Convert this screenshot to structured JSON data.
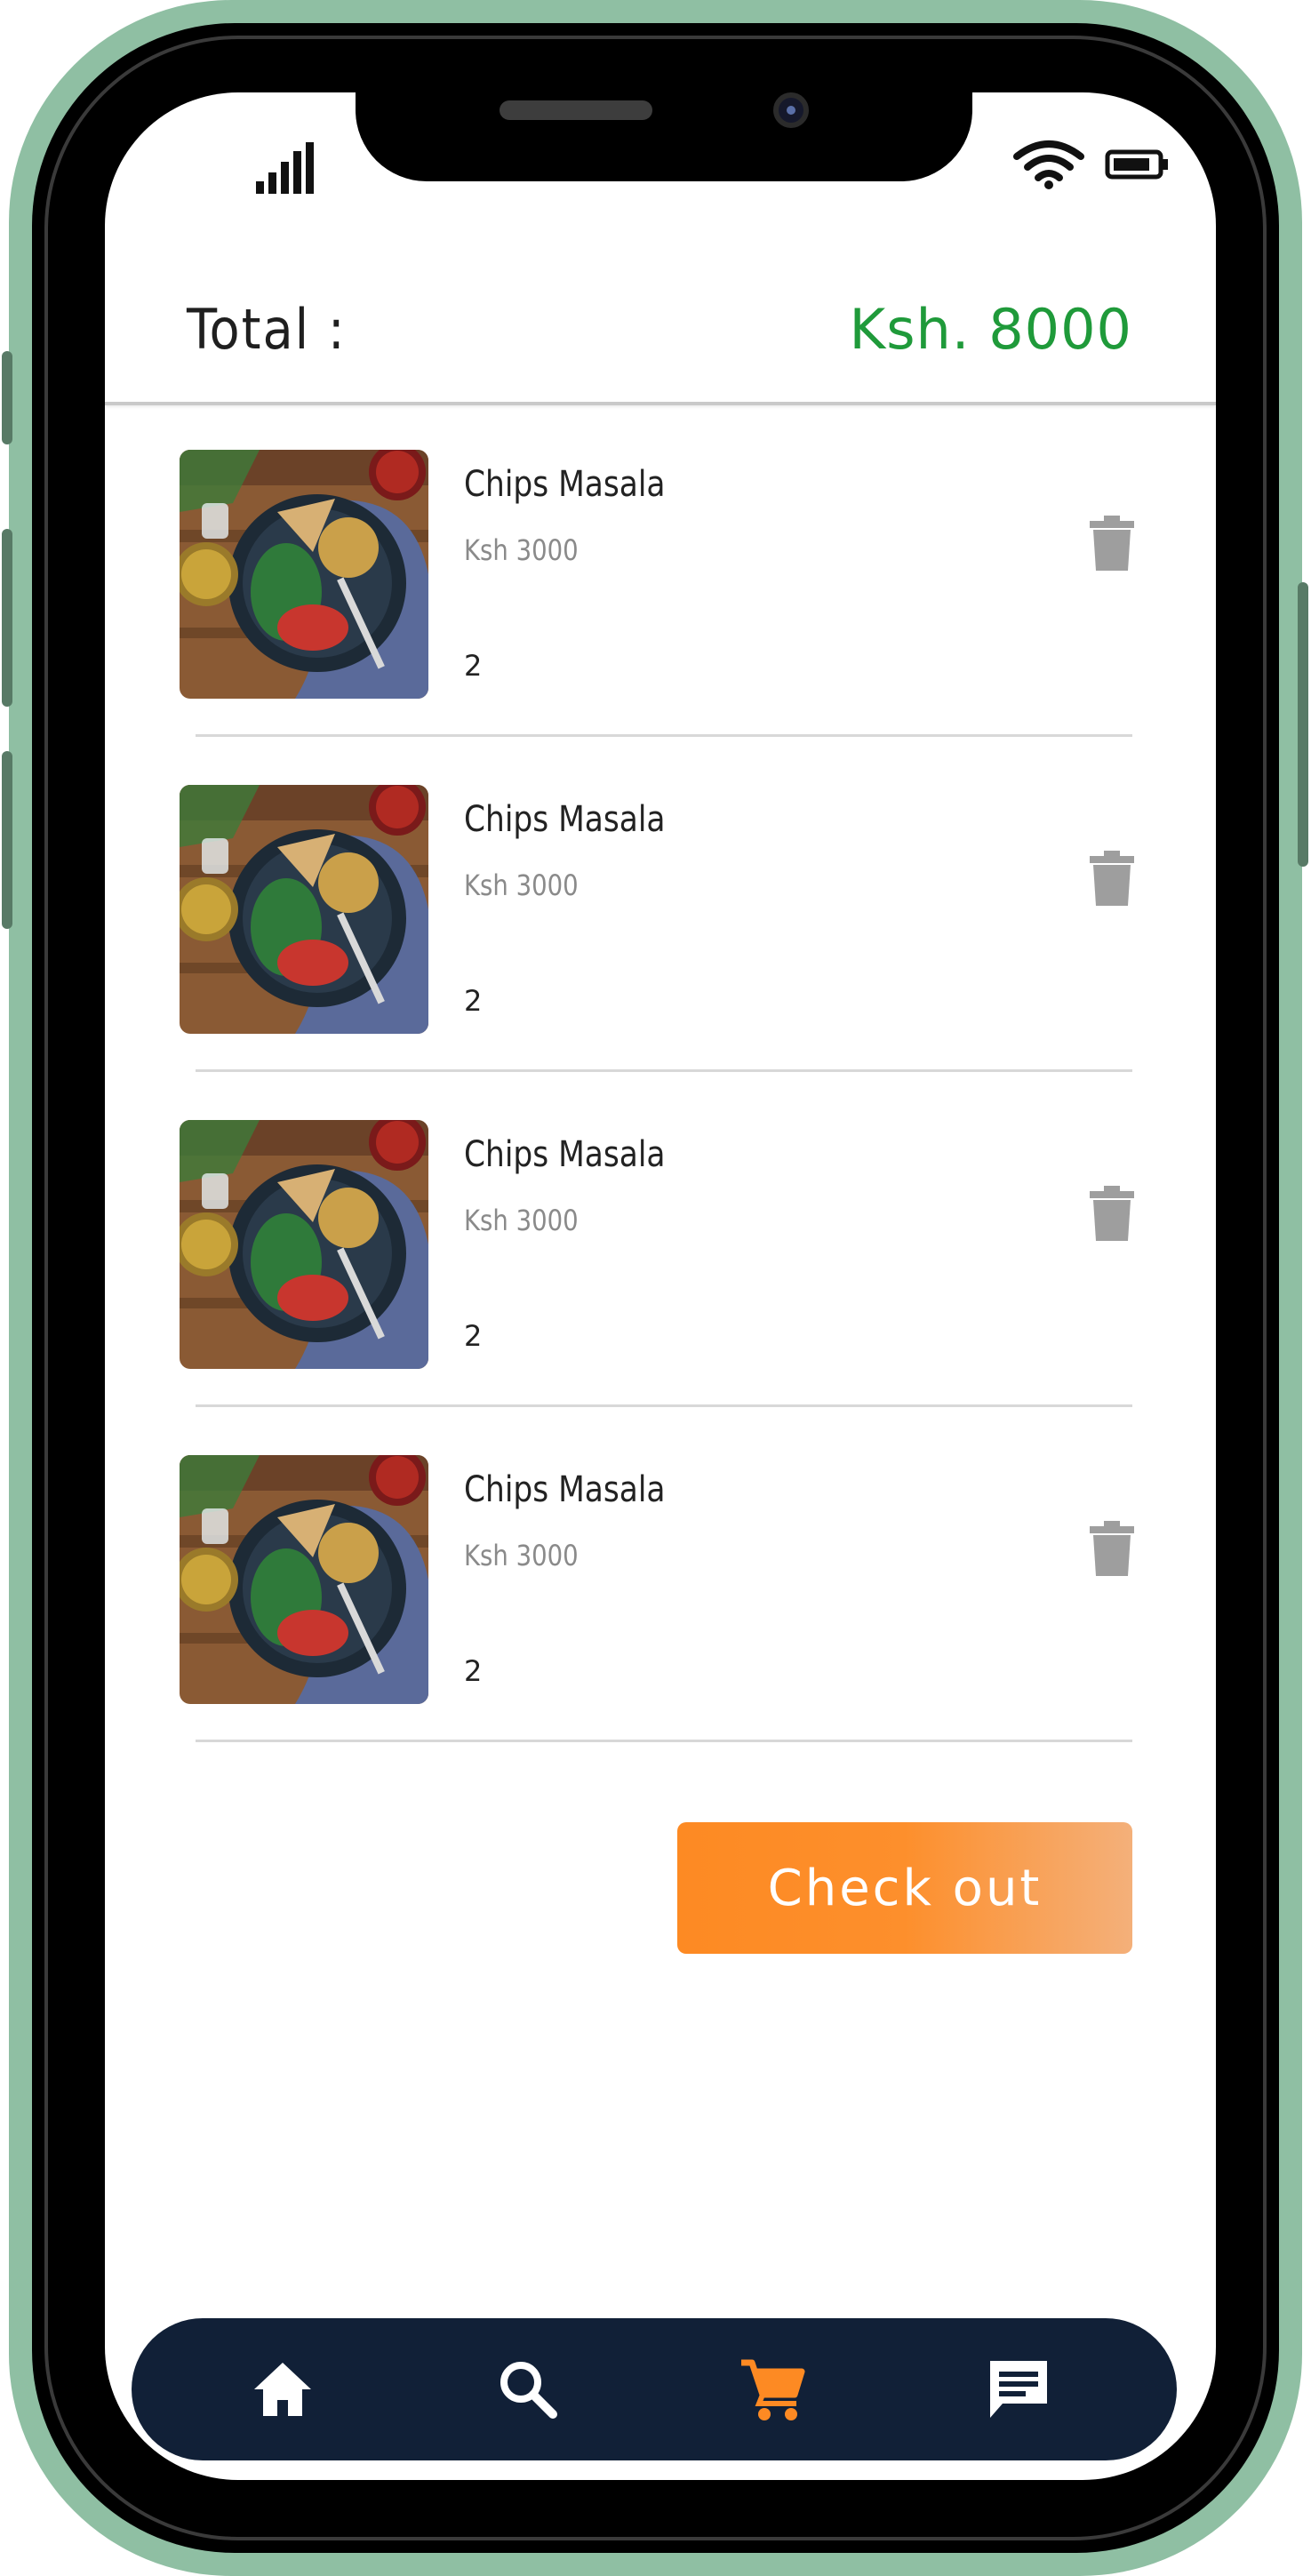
{
  "header": {
    "total_label": "Total :",
    "total_value": "Ksh. 8000",
    "total_color": "#1f9a3a"
  },
  "cart": {
    "items": [
      {
        "name": "Chips Masala",
        "price": "Ksh 3000",
        "qty": "2",
        "delete_icon": "trash-icon"
      },
      {
        "name": "Chips Masala",
        "price": "Ksh 3000",
        "qty": "2",
        "delete_icon": "trash-icon"
      },
      {
        "name": "Chips Masala",
        "price": "Ksh 3000",
        "qty": "2",
        "delete_icon": "trash-icon"
      },
      {
        "name": "Chips Masala",
        "price": "Ksh 3000",
        "qty": "2",
        "delete_icon": "trash-icon"
      }
    ]
  },
  "checkout": {
    "label": "Check out",
    "accent": "#fd8a23"
  },
  "nav": {
    "items": [
      {
        "icon": "home-icon",
        "active": false
      },
      {
        "icon": "search-icon",
        "active": false
      },
      {
        "icon": "cart-icon",
        "active": true
      },
      {
        "icon": "chat-icon",
        "active": false
      }
    ],
    "bg_color": "#112037",
    "active_color": "#fd8a23"
  }
}
